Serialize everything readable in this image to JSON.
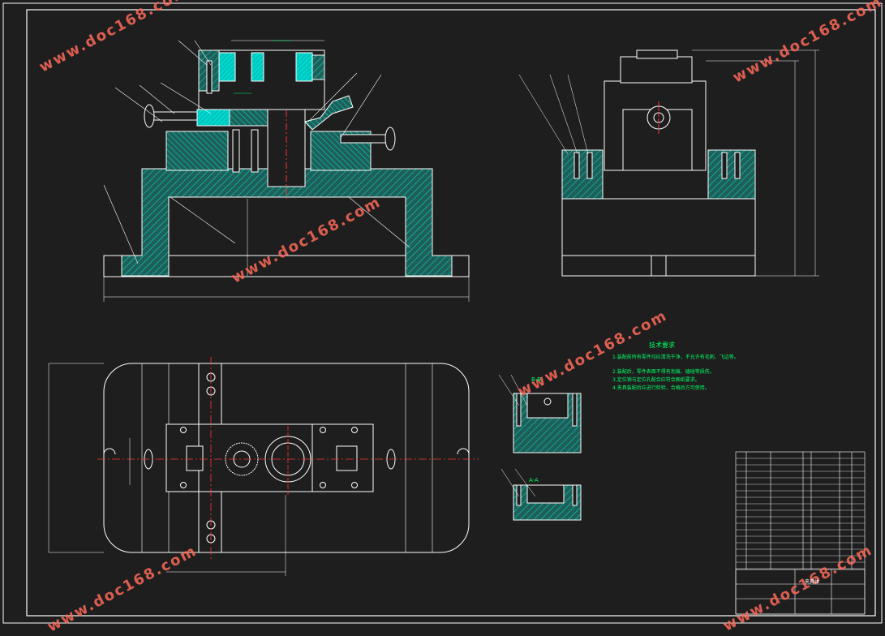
{
  "watermark": {
    "text": "www.doc168.com"
  },
  "technical_requirements": {
    "title": "技术要求",
    "lines": [
      "1.装配前所有零件均应清洗干净，不允许有毛刺、飞边等。",
      "2.装配后，零件表面不得有划痕、磕碰等损伤。",
      "3.定位销与定位孔配合应符合图纸要求。",
      "4.夹具装配后应进行检验，合格后方可使用。"
    ]
  },
  "section_labels": {
    "section_bb": "B-B",
    "section_aa": "A-A"
  },
  "title_block": {
    "drawing_name": "夹具体"
  },
  "colors": {
    "background": "#1e1e1e",
    "outline": "#ffffff",
    "hatch": "#00e5c8",
    "fill": "#1f5f5a",
    "centerline": "#ff3333",
    "dimension": "#00ff66",
    "watermark": "#ff6a5a"
  }
}
